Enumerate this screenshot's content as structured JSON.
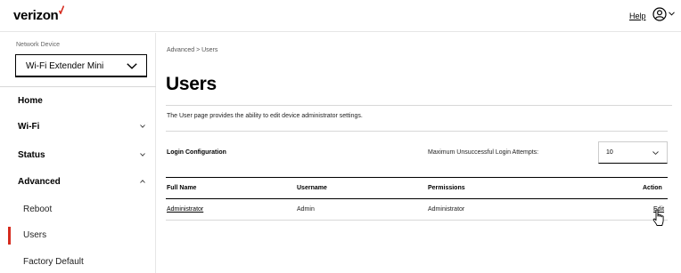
{
  "header": {
    "brand": "verizon",
    "help_label": "Help",
    "user_icon": "user-circle-icon",
    "accent_color": "#d52b1e"
  },
  "sidebar": {
    "network_device_label": "Network Device",
    "device_value": "Wi-Fi Extender Mini",
    "nav": [
      {
        "label": "Home"
      },
      {
        "label": "Wi-Fi"
      },
      {
        "label": "Status"
      },
      {
        "label": "Advanced"
      }
    ],
    "advanced_items": [
      {
        "label": "Reboot"
      },
      {
        "label": "Users"
      },
      {
        "label": "Factory Default"
      }
    ]
  },
  "main": {
    "breadcrumb": "Advanced  >  Users",
    "title": "Users",
    "description": "The User page provides the ability to edit device administrator settings.",
    "login_config_label": "Login Configuration",
    "max_attempts_label": "Maximum Unsuccessful Login Attempts:",
    "max_attempts_value": "10",
    "table": {
      "headers": [
        "Full Name",
        "Username",
        "Permissions",
        "Action"
      ],
      "rows": [
        {
          "full_name": "Administrator",
          "username": "Admin",
          "permissions": "Administrator",
          "action": "Edit"
        }
      ]
    }
  }
}
